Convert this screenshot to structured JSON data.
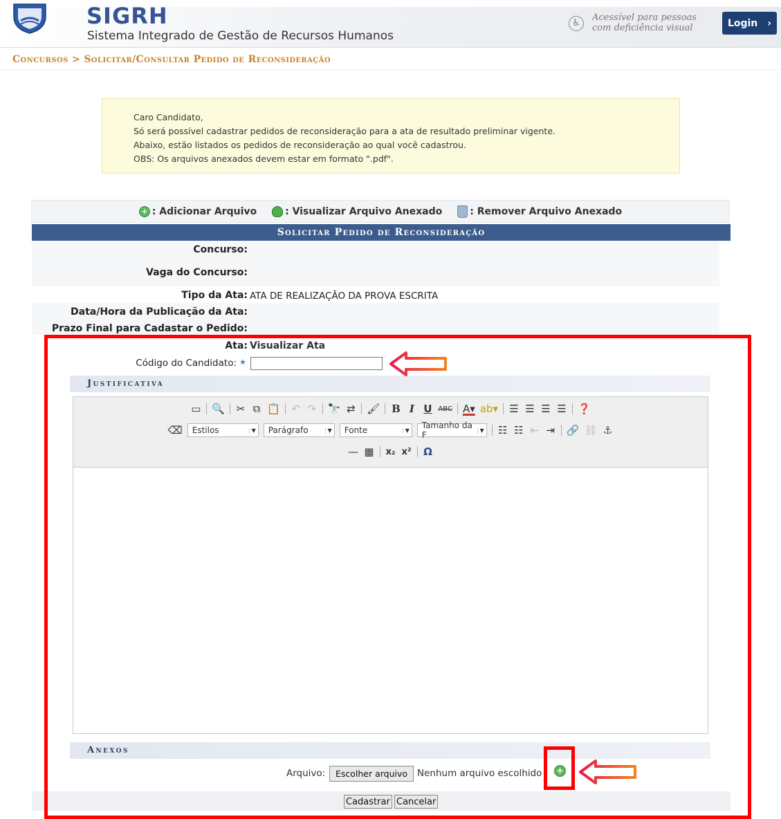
{
  "header": {
    "brand": "SIGRH",
    "subtitle": "Sistema Integrado de Gestão de Recursos Humanos",
    "accessibility_line1": "Acessível para pessoas",
    "accessibility_line2": "com deficiência visual",
    "login_label": "Login",
    "login_chevron": "›"
  },
  "breadcrumb": "Concursos > Solicitar/Consultar Pedido de Reconsideração",
  "info": {
    "line1": "Caro Candidato,",
    "line2": "Só será possível cadastrar pedidos de reconsideração para a ata de resultado preliminar vigente.",
    "line3": "Abaixo, estão listados os pedidos de reconsideração ao qual você cadastrou.",
    "line4": "OBS: Os arquivos anexados devem estar em formato \".pdf\"."
  },
  "legend": {
    "add": ": Adicionar Arquivo",
    "view": ": Visualizar Arquivo Anexado",
    "remove": ": Remover Arquivo Anexado"
  },
  "form": {
    "title": "Solicitar Pedido de Reconsideração",
    "concurso_label": "Concurso:",
    "concurso_value": "",
    "vaga_label": "Vaga do Concurso:",
    "vaga_value": "",
    "tipo_label": "Tipo da Ata:",
    "tipo_value": "ATA DE REALIZAÇÃO DA PROVA ESCRITA",
    "data_label": "Data/Hora da Publicação da Ata:",
    "data_value": "",
    "prazo_label": "Prazo Final para Cadastar o Pedido:",
    "prazo_value": "",
    "ata_label": "Ata:",
    "ata_link": "Visualizar Ata",
    "codigo_label": "Código do Candidato:",
    "required_mark": "★",
    "codigo_value": ""
  },
  "justificativa": {
    "title": "Justificativa",
    "selects": {
      "estilos": "Estilos",
      "paragrafo": "Parágrafo",
      "fonte": "Fonte",
      "tamanho": "Tamanho da F"
    }
  },
  "anexos": {
    "title": "Anexos",
    "arquivo_label": "Arquivo:",
    "choose_button": "Escolher arquivo",
    "no_file": "Nenhum arquivo escolhido"
  },
  "actions": {
    "submit": "Cadastrar",
    "cancel": "Cancelar"
  },
  "colors": {
    "brand_blue": "#355496",
    "form_header": "#3b5c8d",
    "breadcrumb": "#c9822b",
    "annotation_red": "#ff0000"
  }
}
